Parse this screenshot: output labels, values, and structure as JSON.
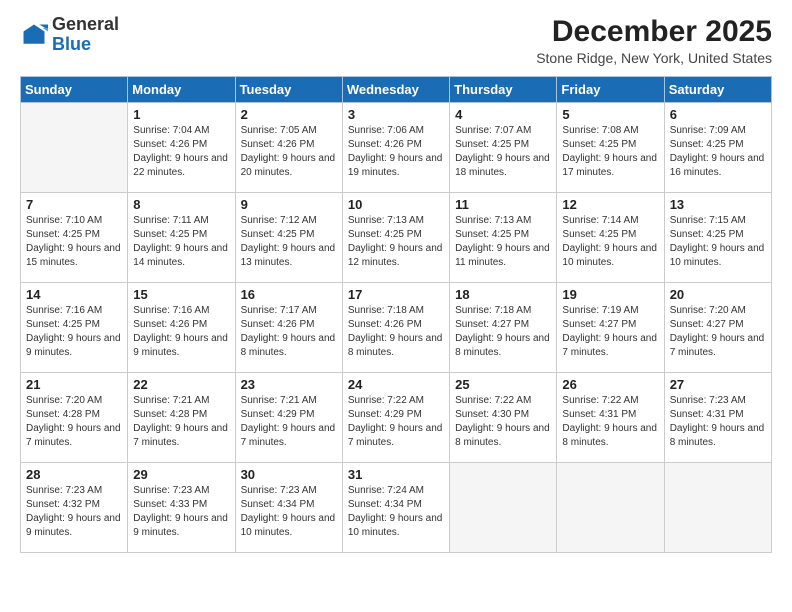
{
  "logo": {
    "general": "General",
    "blue": "Blue"
  },
  "title": "December 2025",
  "subtitle": "Stone Ridge, New York, United States",
  "days_of_week": [
    "Sunday",
    "Monday",
    "Tuesday",
    "Wednesday",
    "Thursday",
    "Friday",
    "Saturday"
  ],
  "weeks": [
    [
      {
        "day": "",
        "sunrise": "",
        "sunset": "",
        "daylight": ""
      },
      {
        "day": "1",
        "sunrise": "Sunrise: 7:04 AM",
        "sunset": "Sunset: 4:26 PM",
        "daylight": "Daylight: 9 hours and 22 minutes."
      },
      {
        "day": "2",
        "sunrise": "Sunrise: 7:05 AM",
        "sunset": "Sunset: 4:26 PM",
        "daylight": "Daylight: 9 hours and 20 minutes."
      },
      {
        "day": "3",
        "sunrise": "Sunrise: 7:06 AM",
        "sunset": "Sunset: 4:26 PM",
        "daylight": "Daylight: 9 hours and 19 minutes."
      },
      {
        "day": "4",
        "sunrise": "Sunrise: 7:07 AM",
        "sunset": "Sunset: 4:25 PM",
        "daylight": "Daylight: 9 hours and 18 minutes."
      },
      {
        "day": "5",
        "sunrise": "Sunrise: 7:08 AM",
        "sunset": "Sunset: 4:25 PM",
        "daylight": "Daylight: 9 hours and 17 minutes."
      },
      {
        "day": "6",
        "sunrise": "Sunrise: 7:09 AM",
        "sunset": "Sunset: 4:25 PM",
        "daylight": "Daylight: 9 hours and 16 minutes."
      }
    ],
    [
      {
        "day": "7",
        "sunrise": "Sunrise: 7:10 AM",
        "sunset": "Sunset: 4:25 PM",
        "daylight": "Daylight: 9 hours and 15 minutes."
      },
      {
        "day": "8",
        "sunrise": "Sunrise: 7:11 AM",
        "sunset": "Sunset: 4:25 PM",
        "daylight": "Daylight: 9 hours and 14 minutes."
      },
      {
        "day": "9",
        "sunrise": "Sunrise: 7:12 AM",
        "sunset": "Sunset: 4:25 PM",
        "daylight": "Daylight: 9 hours and 13 minutes."
      },
      {
        "day": "10",
        "sunrise": "Sunrise: 7:13 AM",
        "sunset": "Sunset: 4:25 PM",
        "daylight": "Daylight: 9 hours and 12 minutes."
      },
      {
        "day": "11",
        "sunrise": "Sunrise: 7:13 AM",
        "sunset": "Sunset: 4:25 PM",
        "daylight": "Daylight: 9 hours and 11 minutes."
      },
      {
        "day": "12",
        "sunrise": "Sunrise: 7:14 AM",
        "sunset": "Sunset: 4:25 PM",
        "daylight": "Daylight: 9 hours and 10 minutes."
      },
      {
        "day": "13",
        "sunrise": "Sunrise: 7:15 AM",
        "sunset": "Sunset: 4:25 PM",
        "daylight": "Daylight: 9 hours and 10 minutes."
      }
    ],
    [
      {
        "day": "14",
        "sunrise": "Sunrise: 7:16 AM",
        "sunset": "Sunset: 4:25 PM",
        "daylight": "Daylight: 9 hours and 9 minutes."
      },
      {
        "day": "15",
        "sunrise": "Sunrise: 7:16 AM",
        "sunset": "Sunset: 4:26 PM",
        "daylight": "Daylight: 9 hours and 9 minutes."
      },
      {
        "day": "16",
        "sunrise": "Sunrise: 7:17 AM",
        "sunset": "Sunset: 4:26 PM",
        "daylight": "Daylight: 9 hours and 8 minutes."
      },
      {
        "day": "17",
        "sunrise": "Sunrise: 7:18 AM",
        "sunset": "Sunset: 4:26 PM",
        "daylight": "Daylight: 9 hours and 8 minutes."
      },
      {
        "day": "18",
        "sunrise": "Sunrise: 7:18 AM",
        "sunset": "Sunset: 4:27 PM",
        "daylight": "Daylight: 9 hours and 8 minutes."
      },
      {
        "day": "19",
        "sunrise": "Sunrise: 7:19 AM",
        "sunset": "Sunset: 4:27 PM",
        "daylight": "Daylight: 9 hours and 7 minutes."
      },
      {
        "day": "20",
        "sunrise": "Sunrise: 7:20 AM",
        "sunset": "Sunset: 4:27 PM",
        "daylight": "Daylight: 9 hours and 7 minutes."
      }
    ],
    [
      {
        "day": "21",
        "sunrise": "Sunrise: 7:20 AM",
        "sunset": "Sunset: 4:28 PM",
        "daylight": "Daylight: 9 hours and 7 minutes."
      },
      {
        "day": "22",
        "sunrise": "Sunrise: 7:21 AM",
        "sunset": "Sunset: 4:28 PM",
        "daylight": "Daylight: 9 hours and 7 minutes."
      },
      {
        "day": "23",
        "sunrise": "Sunrise: 7:21 AM",
        "sunset": "Sunset: 4:29 PM",
        "daylight": "Daylight: 9 hours and 7 minutes."
      },
      {
        "day": "24",
        "sunrise": "Sunrise: 7:22 AM",
        "sunset": "Sunset: 4:29 PM",
        "daylight": "Daylight: 9 hours and 7 minutes."
      },
      {
        "day": "25",
        "sunrise": "Sunrise: 7:22 AM",
        "sunset": "Sunset: 4:30 PM",
        "daylight": "Daylight: 9 hours and 8 minutes."
      },
      {
        "day": "26",
        "sunrise": "Sunrise: 7:22 AM",
        "sunset": "Sunset: 4:31 PM",
        "daylight": "Daylight: 9 hours and 8 minutes."
      },
      {
        "day": "27",
        "sunrise": "Sunrise: 7:23 AM",
        "sunset": "Sunset: 4:31 PM",
        "daylight": "Daylight: 9 hours and 8 minutes."
      }
    ],
    [
      {
        "day": "28",
        "sunrise": "Sunrise: 7:23 AM",
        "sunset": "Sunset: 4:32 PM",
        "daylight": "Daylight: 9 hours and 9 minutes."
      },
      {
        "day": "29",
        "sunrise": "Sunrise: 7:23 AM",
        "sunset": "Sunset: 4:33 PM",
        "daylight": "Daylight: 9 hours and 9 minutes."
      },
      {
        "day": "30",
        "sunrise": "Sunrise: 7:23 AM",
        "sunset": "Sunset: 4:34 PM",
        "daylight": "Daylight: 9 hours and 10 minutes."
      },
      {
        "day": "31",
        "sunrise": "Sunrise: 7:24 AM",
        "sunset": "Sunset: 4:34 PM",
        "daylight": "Daylight: 9 hours and 10 minutes."
      },
      {
        "day": "",
        "sunrise": "",
        "sunset": "",
        "daylight": ""
      },
      {
        "day": "",
        "sunrise": "",
        "sunset": "",
        "daylight": ""
      },
      {
        "day": "",
        "sunrise": "",
        "sunset": "",
        "daylight": ""
      }
    ]
  ]
}
